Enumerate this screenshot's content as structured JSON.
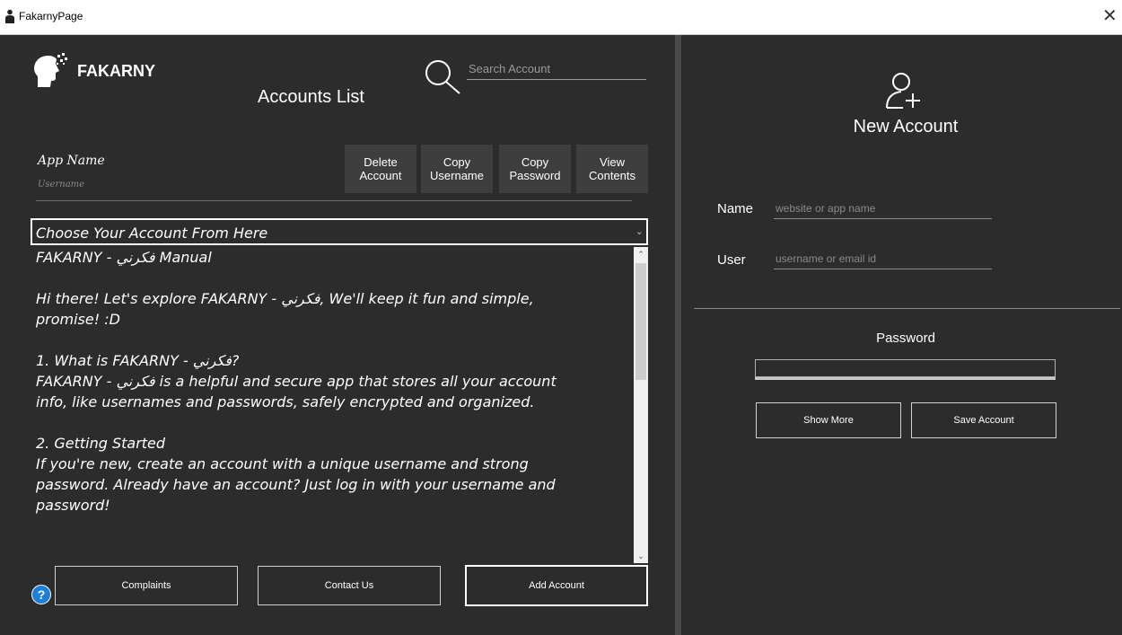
{
  "window": {
    "title": "FakarnyPage",
    "close_glyph": "✕",
    "app_icon": "person-icon"
  },
  "header": {
    "brand": "FAKARNY",
    "logo_icon": "head-logo-icon",
    "search_placeholder": "Search Account",
    "list_title": "Accounts List"
  },
  "accounts_header": {
    "app_name": "App Name",
    "username": "Username"
  },
  "actions": {
    "delete": "Delete\nAccount",
    "copy_username": "Copy\nUsername",
    "copy_password": "Copy\nPassword",
    "view_contents": "View\nContents"
  },
  "account_selector": {
    "selected": "Choose Your Account From Here"
  },
  "manual": {
    "lines": [
      "FAKARNY - فكرني Manual",
      "",
      "Hi there! Let's explore FAKARNY - فكرني, We'll keep it fun and simple,",
      "promise! :D",
      "",
      "1. What is FAKARNY - فكرني?",
      "FAKARNY - فكرني is a helpful and secure app that stores all your account",
      "info, like usernames and passwords, safely encrypted and organized.",
      "",
      "2. Getting Started",
      "If you're new, create an account with a unique username and strong",
      "password. Already have an account? Just log in with your username and",
      "password!"
    ]
  },
  "footer": {
    "help_glyph": "?",
    "complaints": "Complaints",
    "contact": "Contact Us",
    "add_account": "Add Account"
  },
  "new_account": {
    "title": "New Account",
    "name_label": "Name",
    "name_placeholder": "website or app name",
    "user_label": "User",
    "user_placeholder": "username or email id",
    "password_label": "Password",
    "password_value": "",
    "show_more": "Show More",
    "save": "Save Account"
  },
  "colors": {
    "background": "#2c2c2c",
    "divider": "#4a4a4a",
    "text": "#ffffff",
    "help": "#1f7fd6"
  }
}
